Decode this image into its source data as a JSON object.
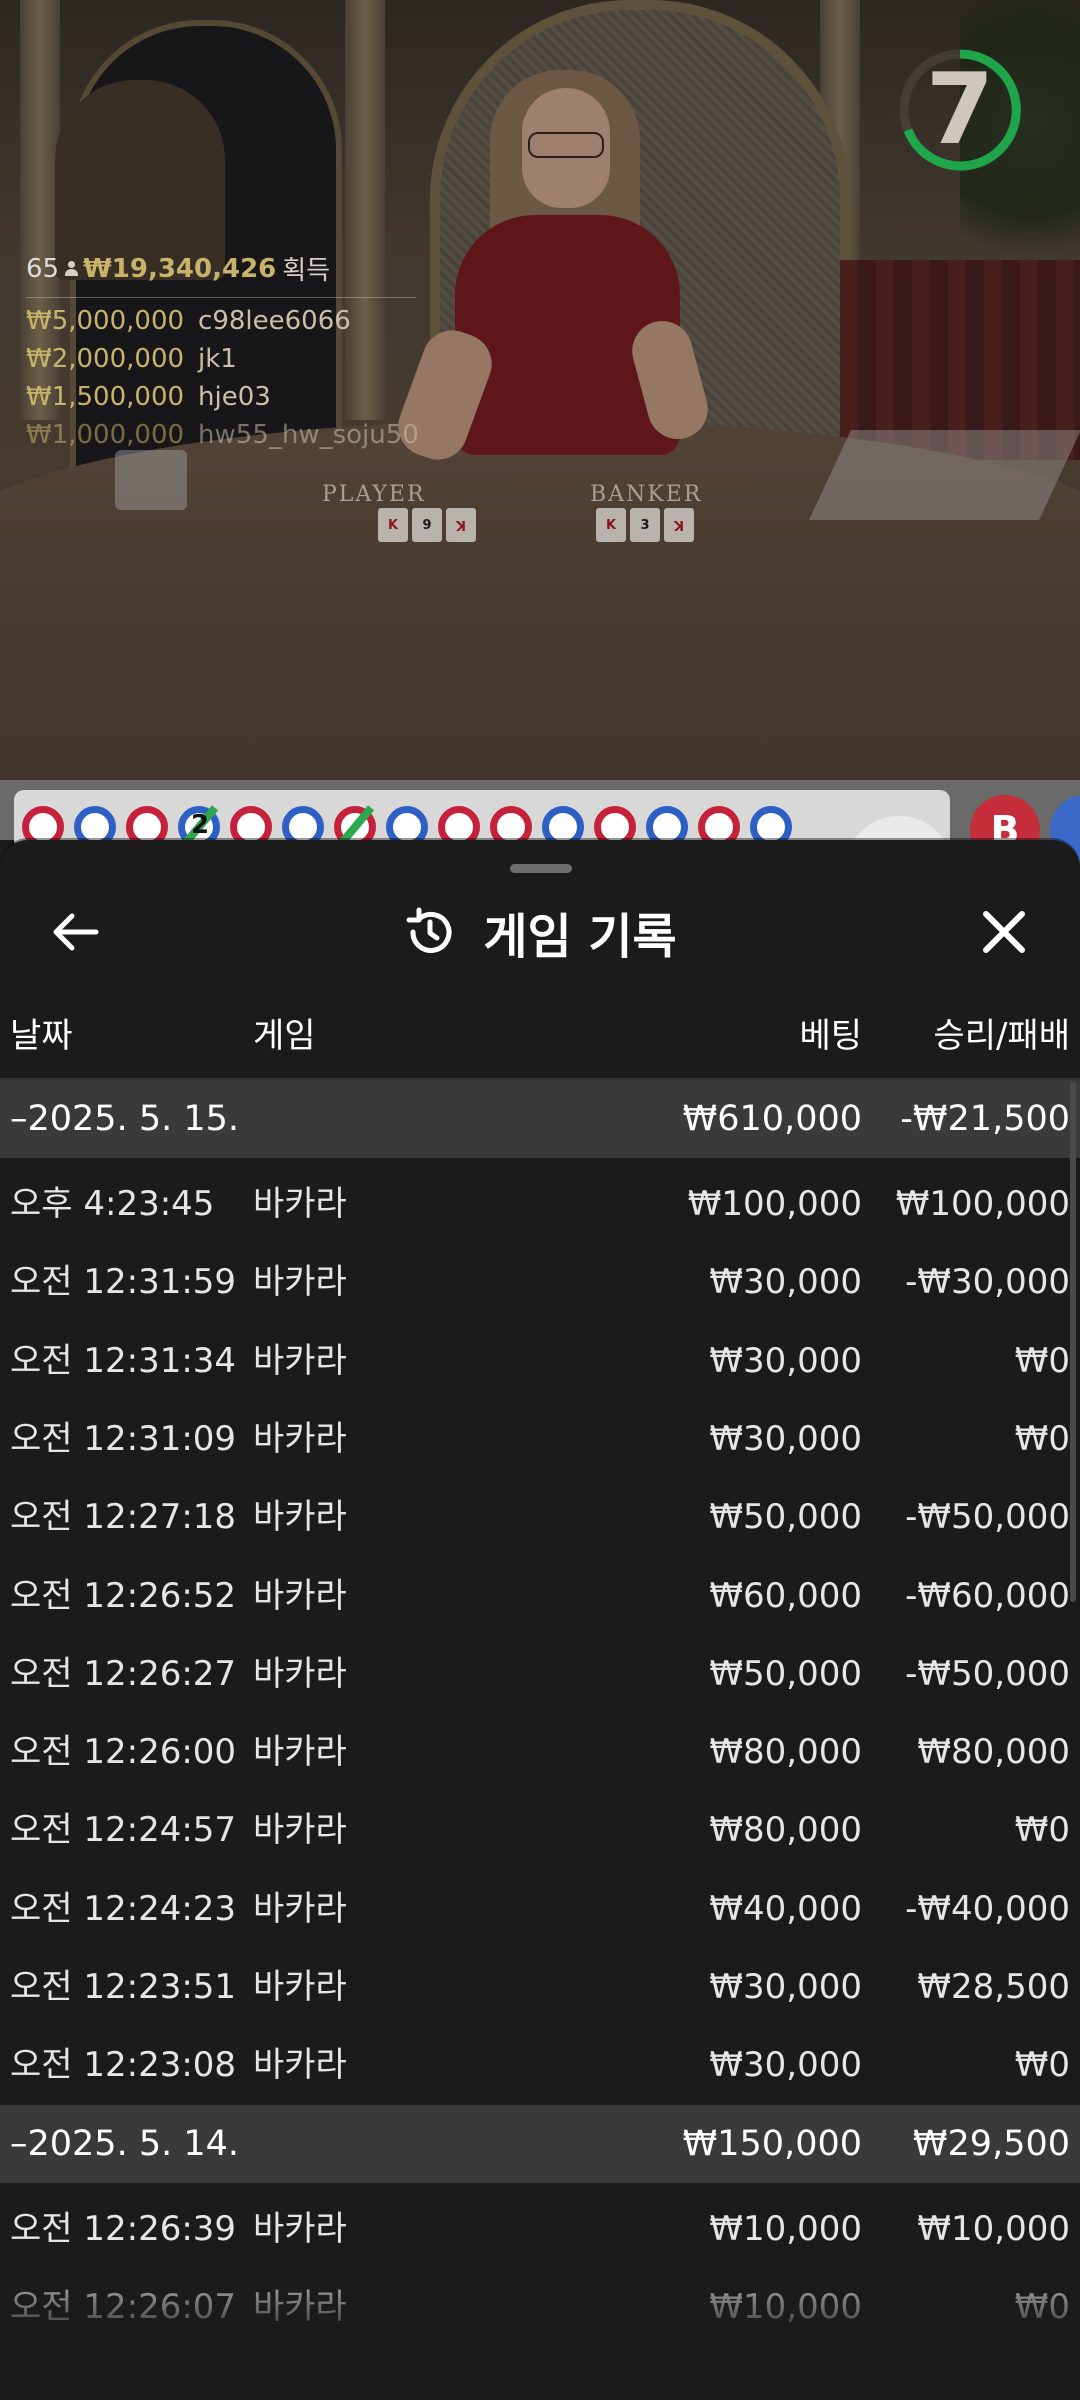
{
  "video": {
    "timer": "7",
    "table_labels": {
      "player": "PLAYER",
      "banker": "BANKER"
    },
    "player_cards": [
      "K",
      "9",
      "K"
    ],
    "banker_cards": [
      "K",
      "3",
      "K"
    ]
  },
  "winners": {
    "count": "65",
    "total": "₩19,340,426",
    "total_label": "획득",
    "list": [
      {
        "amount": "₩5,000,000",
        "user": "c98lee6066"
      },
      {
        "amount": "₩2,000,000",
        "user": "jk1"
      },
      {
        "amount": "₩1,500,000",
        "user": "hje03"
      },
      {
        "amount": "₩1,000,000",
        "user": "hw55_hw_soju50"
      }
    ]
  },
  "road": {
    "beads": [
      "P",
      "B",
      "P",
      "B",
      "P",
      "B",
      "P",
      "B",
      "P",
      "P",
      "B",
      "P",
      "B",
      "P",
      "B"
    ],
    "bead_number": "2",
    "ball_label": "B"
  },
  "sheet": {
    "title": "게임 기록",
    "columns": {
      "date": "날짜",
      "game": "게임",
      "bet": "베팅",
      "result": "승리/패배"
    },
    "rows": [
      {
        "type": "group",
        "time": "–2025. 5. 15.",
        "game": "",
        "bet": "₩610,000",
        "result": "-₩21,500"
      },
      {
        "type": "item",
        "time": "오후 4:23:45",
        "game": "바카라",
        "bet": "₩100,000",
        "result": "₩100,000"
      },
      {
        "type": "item",
        "time": "오전 12:31:59",
        "game": "바카라",
        "bet": "₩30,000",
        "result": "-₩30,000"
      },
      {
        "type": "item",
        "time": "오전 12:31:34",
        "game": "바카라",
        "bet": "₩30,000",
        "result": "₩0"
      },
      {
        "type": "item",
        "time": "오전 12:31:09",
        "game": "바카라",
        "bet": "₩30,000",
        "result": "₩0"
      },
      {
        "type": "item",
        "time": "오전 12:27:18",
        "game": "바카라",
        "bet": "₩50,000",
        "result": "-₩50,000"
      },
      {
        "type": "item",
        "time": "오전 12:26:52",
        "game": "바카라",
        "bet": "₩60,000",
        "result": "-₩60,000"
      },
      {
        "type": "item",
        "time": "오전 12:26:27",
        "game": "바카라",
        "bet": "₩50,000",
        "result": "-₩50,000"
      },
      {
        "type": "item",
        "time": "오전 12:26:00",
        "game": "바카라",
        "bet": "₩80,000",
        "result": "₩80,000"
      },
      {
        "type": "item",
        "time": "오전 12:24:57",
        "game": "바카라",
        "bet": "₩80,000",
        "result": "₩0"
      },
      {
        "type": "item",
        "time": "오전 12:24:23",
        "game": "바카라",
        "bet": "₩40,000",
        "result": "-₩40,000"
      },
      {
        "type": "item",
        "time": "오전 12:23:51",
        "game": "바카라",
        "bet": "₩30,000",
        "result": "₩28,500"
      },
      {
        "type": "item",
        "time": "오전 12:23:08",
        "game": "바카라",
        "bet": "₩30,000",
        "result": "₩0"
      },
      {
        "type": "group",
        "time": "–2025. 5. 14.",
        "game": "",
        "bet": "₩150,000",
        "result": "₩29,500"
      },
      {
        "type": "item",
        "time": "오전 12:26:39",
        "game": "바카라",
        "bet": "₩10,000",
        "result": "₩10,000"
      },
      {
        "type": "item",
        "time": "오전 12:26:07",
        "game": "바카라",
        "bet": "₩10,000",
        "result": "₩0"
      }
    ]
  },
  "colors": {
    "accent_green": "#1fa64a",
    "gold": "#c8b36a",
    "player_blue": "#2d5fc4",
    "banker_red": "#c6213a",
    "group_row": "#3a3a3a"
  }
}
